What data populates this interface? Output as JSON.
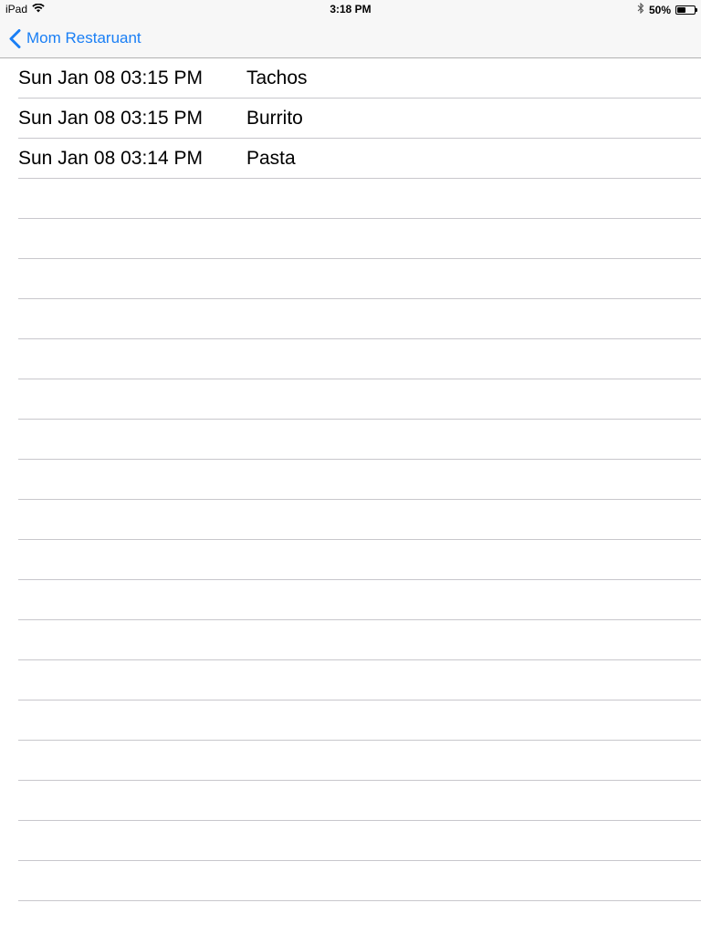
{
  "status_bar": {
    "carrier": "iPad",
    "wifi_icon": "wifi-icon",
    "time": "3:18 PM",
    "bluetooth_icon": "bluetooth-icon",
    "battery_text": "50%",
    "battery_level": 0.5
  },
  "nav": {
    "back_label": "Mom Restaruant",
    "back_icon": "chevron-left-icon",
    "accent_color": "#1a7ff5"
  },
  "orders": [
    {
      "date": "Sun Jan 08 03:15 PM",
      "item": "Tachos"
    },
    {
      "date": "Sun Jan 08 03:15 PM",
      "item": "Burrito"
    },
    {
      "date": "Sun Jan 08 03:14 PM",
      "item": "Pasta"
    }
  ],
  "empty_rows": 18
}
